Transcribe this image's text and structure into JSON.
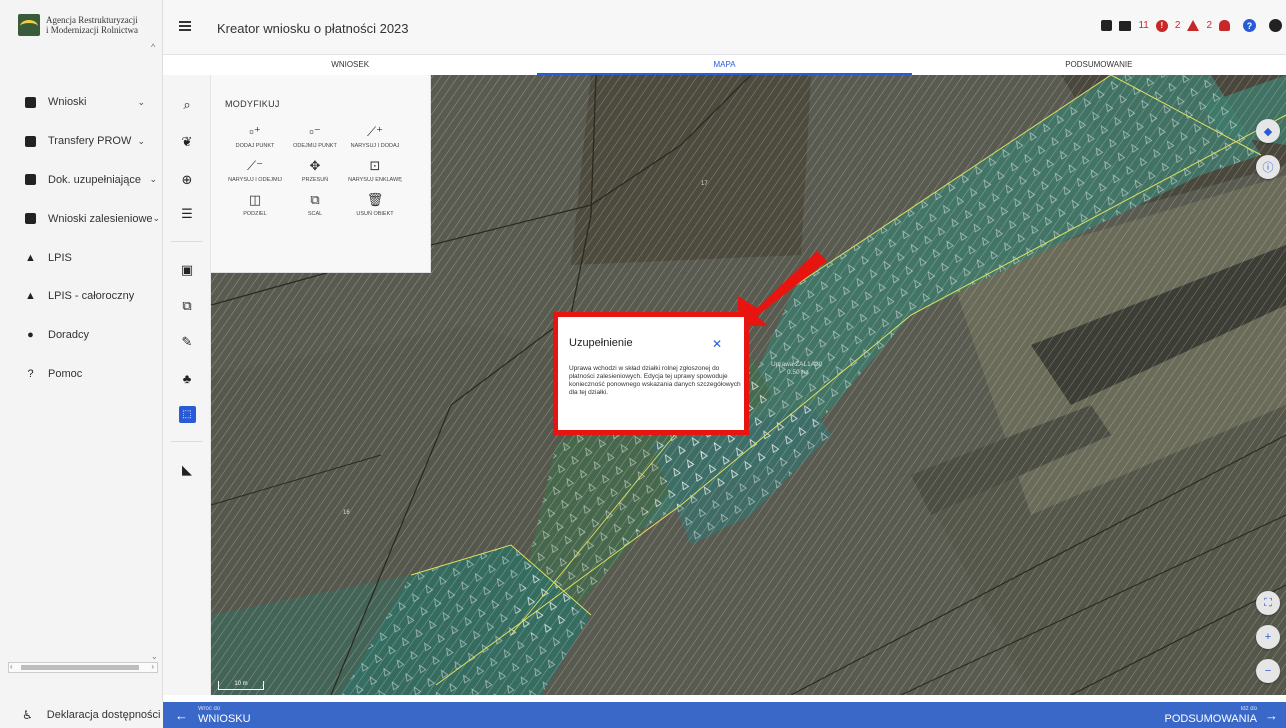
{
  "logo": {
    "line1": "Agencja Restrukturyzacji",
    "line2": "i Modernizacji Rolnictwa"
  },
  "header": {
    "title": "Kreator wniosku o płatności 2023",
    "errors_count": "11",
    "warnings_count": "2",
    "notices_count": "2"
  },
  "tabs": [
    {
      "label": "WNIOSEK"
    },
    {
      "label": "MAPA"
    },
    {
      "label": "PODSUMOWANIE"
    }
  ],
  "sidebar": {
    "items": [
      {
        "label": "Wnioski",
        "icon": "document-icon",
        "chevron": true
      },
      {
        "label": "Transfery PROW",
        "icon": "document-icon",
        "chevron": true
      },
      {
        "label": "Dok. uzupełniające",
        "icon": "document-icon",
        "chevron": true
      },
      {
        "label": "Wnioski zalesieniowe",
        "icon": "document-icon",
        "chevron": true
      },
      {
        "label": "LPIS",
        "icon": "mountain-icon",
        "chevron": false
      },
      {
        "label": "LPIS - całoroczny",
        "icon": "mountain-icon",
        "chevron": false
      },
      {
        "label": "Doradcy",
        "icon": "person-icon",
        "chevron": false
      },
      {
        "label": "Pomoc",
        "icon": "help-icon",
        "chevron": false
      }
    ],
    "footer": "Deklaracja dostępności"
  },
  "modify_panel": {
    "title": "MODYFIKUJ",
    "tools": [
      {
        "label": "DODAJ PUNKT",
        "icon": "add-vertex-icon"
      },
      {
        "label": "ODEJMIJ PUNKT",
        "icon": "remove-vertex-icon"
      },
      {
        "label": "NARYSUJ I DODAJ",
        "icon": "draw-add-icon"
      },
      {
        "label": "NARYSUJ I ODEJMIJ",
        "icon": "draw-subtract-icon"
      },
      {
        "label": "PRZESUŃ",
        "icon": "move-icon"
      },
      {
        "label": "NARYSUJ ENKLAWĘ",
        "icon": "draw-enclave-icon"
      },
      {
        "label": "PODZIEL",
        "icon": "split-icon"
      },
      {
        "label": "SCAL",
        "icon": "merge-icon"
      },
      {
        "label": "USUŃ OBIEKT",
        "icon": "delete-icon"
      }
    ]
  },
  "map": {
    "parcel_labels": [
      {
        "text": "17"
      },
      {
        "text": "16"
      }
    ],
    "crop_label_line1": "Uprawa ZAL1A20",
    "crop_label_line2": "0.50 ha",
    "scale": "10 m"
  },
  "popup": {
    "title": "Uzupełnienie",
    "body": "Uprawa wchodzi w skład działki rolnej zgłoszonej do płatności zalesieniowych. Edycja tej uprawy spowoduje konieczność ponownego wskazania danych szczegółowych dla tej działki."
  },
  "bottom": {
    "back_small": "Wróć do",
    "back_big": "WNIOSKU",
    "next_small": "Idź do",
    "next_big": "PODSUMOWANIA"
  },
  "colors": {
    "accent": "#2a5bd7",
    "bottom_bar": "#3a68c9",
    "highlight_red": "#e8140f",
    "error_red": "#c62828"
  }
}
